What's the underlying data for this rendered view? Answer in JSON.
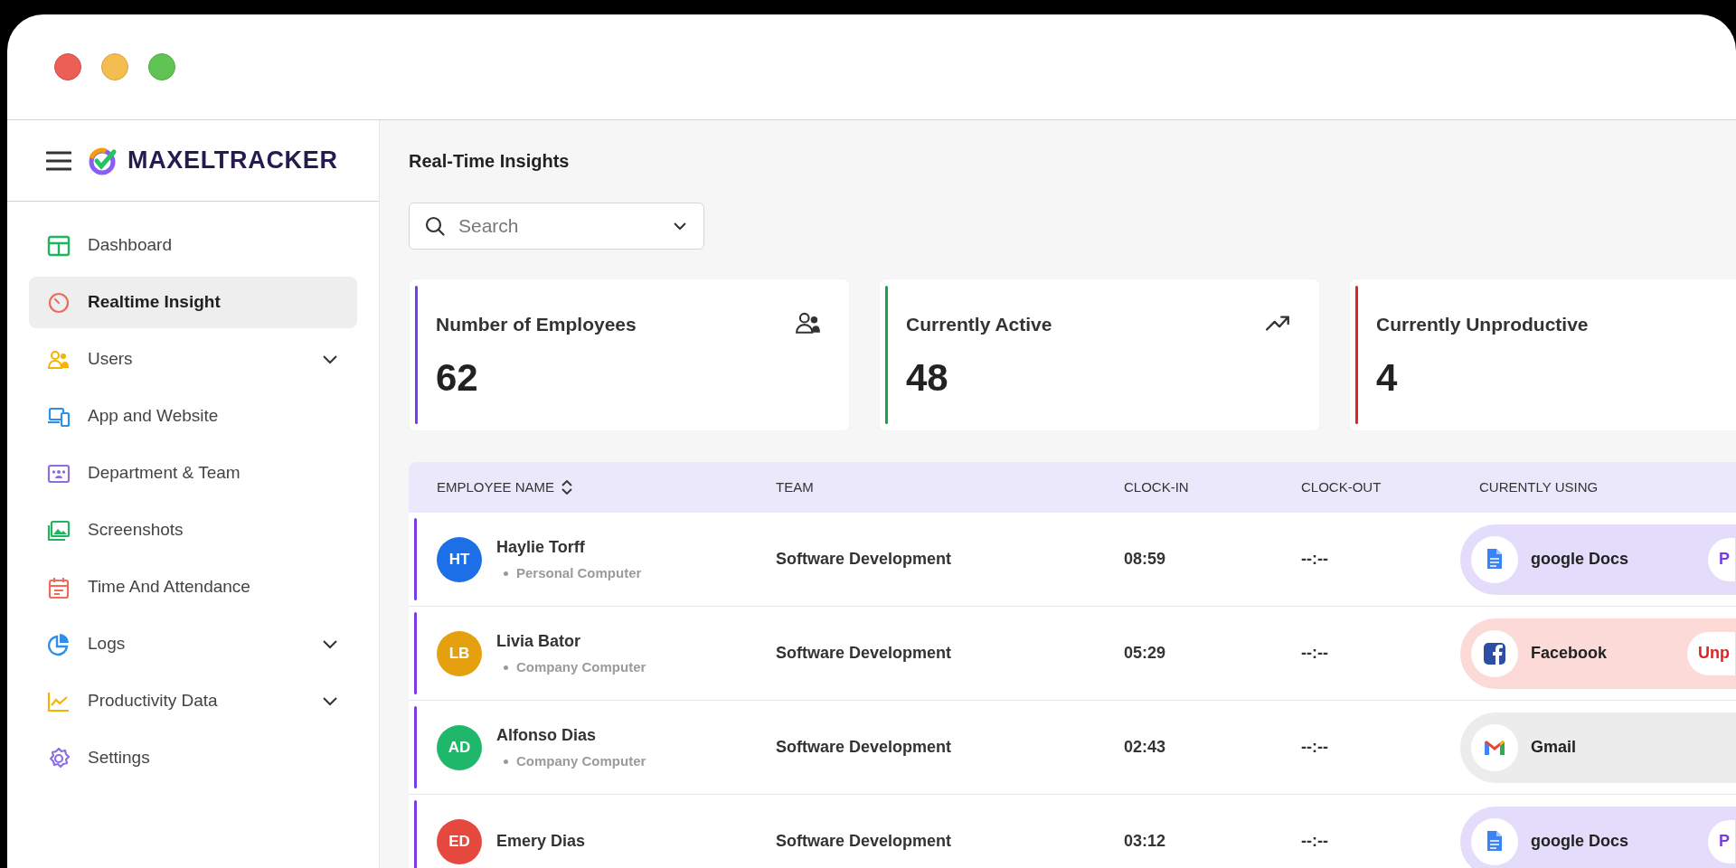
{
  "brand": {
    "name": "MAXELTRACKER"
  },
  "sidebar": {
    "items": [
      {
        "label": "Dashboard",
        "selected": false
      },
      {
        "label": "Realtime Insight",
        "selected": true
      },
      {
        "label": "Users",
        "selected": false,
        "expanded": false
      },
      {
        "label": "App and Website",
        "selected": false
      },
      {
        "label": "Department & Team",
        "selected": false
      },
      {
        "label": "Screenshots",
        "selected": false
      },
      {
        "label": "Time And Attendance",
        "selected": false
      },
      {
        "label": "Logs",
        "selected": false,
        "expanded": false
      },
      {
        "label": "Productivity Data",
        "selected": false,
        "expanded": false
      },
      {
        "label": "Settings",
        "selected": false
      }
    ]
  },
  "page": {
    "title": "Real-Time Insights"
  },
  "search": {
    "placeholder": "Search"
  },
  "cards": [
    {
      "title": "Number of Employees",
      "value": "62",
      "color": "#7c3aed"
    },
    {
      "title": "Currently Active",
      "value": "48",
      "color": "#16a34a"
    },
    {
      "title": "Currently Unproductive",
      "value": "4",
      "color": "#dc2626"
    }
  ],
  "table": {
    "columns": [
      "EMPLOYEE NAME",
      "TEAM",
      "CLOCK-IN",
      "CLOCK-OUT",
      "CURENTLY USING"
    ],
    "rows": [
      {
        "initials": "HT",
        "name": "Haylie Torff",
        "device": "Personal Computer",
        "color": "#1d6fe8",
        "team": "Software Development",
        "clock_in": "08:59",
        "clock_out": "--:--",
        "app": {
          "kind": "docs",
          "name": "google Docs",
          "color": "#e3dcfb",
          "badge": {
            "text": "P",
            "color": "#7c3aed"
          }
        }
      },
      {
        "initials": "LB",
        "name": "Livia Bator",
        "device": "Company Computer",
        "color": "#e5a00d",
        "team": "Software Development",
        "clock_in": "05:29",
        "clock_out": "--:--",
        "app": {
          "kind": "facebook",
          "name": "Facebook",
          "color": "#fbdad7",
          "badge": {
            "text": "Unp",
            "color": "#dc2626"
          }
        }
      },
      {
        "initials": "AD",
        "name": "Alfonso Dias",
        "device": "Company Computer",
        "color": "#1fb76a",
        "team": "Software Development",
        "clock_in": "02:43",
        "clock_out": "--:--",
        "app": {
          "kind": "gmail",
          "name": "Gmail",
          "color": "#ececec"
        }
      },
      {
        "initials": "ED",
        "name": "Emery Dias",
        "color": "#e5483d",
        "team": "Software Development",
        "clock_in": "03:12",
        "clock_out": "--:--",
        "app": {
          "kind": "docs",
          "name": "google Docs",
          "color": "#e3dcfb",
          "badge": {
            "text": "P",
            "color": "#7c3aed"
          }
        }
      }
    ]
  }
}
